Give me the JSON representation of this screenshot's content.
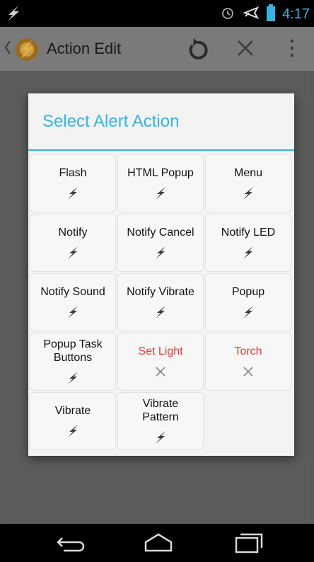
{
  "status_bar": {
    "time": "4:17",
    "icons": [
      "tasker-icon",
      "alarm-icon",
      "airplane-icon",
      "battery-icon"
    ]
  },
  "action_bar": {
    "title": "Action Edit",
    "icons": [
      "back-chevron-icon",
      "tasker-app-icon",
      "undo-icon",
      "close-icon",
      "overflow-menu-icon"
    ]
  },
  "dialog": {
    "title": "Select Alert Action",
    "accent_color": "#33b5e5",
    "disabled_color": "#e6393b",
    "items": [
      {
        "label": "Flash",
        "enabled": true
      },
      {
        "label": "HTML Popup",
        "enabled": true
      },
      {
        "label": "Menu",
        "enabled": true
      },
      {
        "label": "Notify",
        "enabled": true
      },
      {
        "label": "Notify Cancel",
        "enabled": true
      },
      {
        "label": "Notify LED",
        "enabled": true
      },
      {
        "label": "Notify Sound",
        "enabled": true
      },
      {
        "label": "Notify Vibrate",
        "enabled": true
      },
      {
        "label": "Popup",
        "enabled": true
      },
      {
        "label": "Popup Task Buttons",
        "enabled": true
      },
      {
        "label": "Set Light",
        "enabled": false
      },
      {
        "label": "Torch",
        "enabled": false
      },
      {
        "label": "Vibrate",
        "enabled": true
      },
      {
        "label": "Vibrate Pattern",
        "enabled": true
      }
    ]
  },
  "nav_bar": {
    "icons": [
      "back-icon",
      "home-icon",
      "recents-icon"
    ]
  }
}
